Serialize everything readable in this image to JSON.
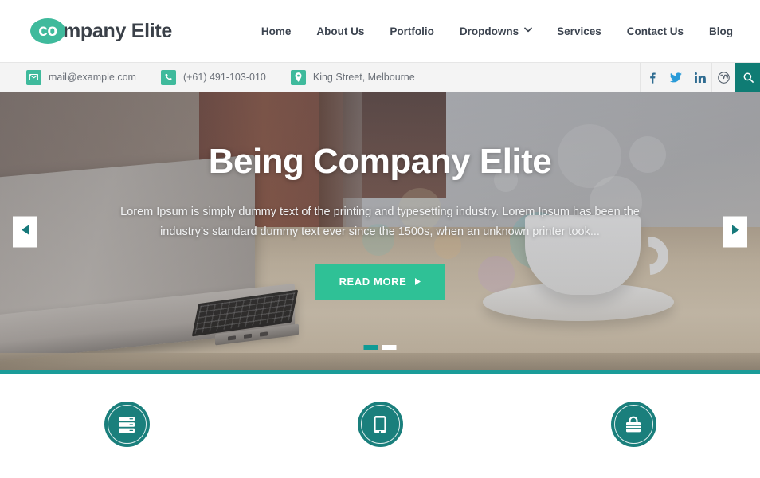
{
  "brand": {
    "logo_mark_text": "co",
    "logo_text": "mpany Elite",
    "accent_green": "#3fba9c",
    "accent_teal": "#0f7c74",
    "accent_button": "#2fc196",
    "dark_text": "#3a4048"
  },
  "nav": {
    "items": [
      {
        "label": "Home",
        "has_dropdown": false
      },
      {
        "label": "About Us",
        "has_dropdown": false
      },
      {
        "label": "Portfolio",
        "has_dropdown": false
      },
      {
        "label": "Dropdowns",
        "has_dropdown": true
      },
      {
        "label": "Services",
        "has_dropdown": false
      },
      {
        "label": "Contact Us",
        "has_dropdown": false
      },
      {
        "label": "Blog",
        "has_dropdown": false
      }
    ]
  },
  "topbar": {
    "contacts": [
      {
        "icon": "envelope-icon",
        "text": "mail@example.com"
      },
      {
        "icon": "phone-icon",
        "text": "(+61) 491-103-010"
      },
      {
        "icon": "map-pin-icon",
        "text": "King Street, Melbourne"
      }
    ],
    "socials": [
      {
        "icon": "facebook-icon",
        "label": "Facebook"
      },
      {
        "icon": "twitter-icon",
        "label": "Twitter"
      },
      {
        "icon": "linkedin-icon",
        "label": "LinkedIn"
      },
      {
        "icon": "wordpress-icon",
        "label": "WordPress"
      },
      {
        "icon": "search-icon",
        "label": "Search"
      }
    ]
  },
  "hero": {
    "title": "Being Company Elite",
    "subtitle": "Lorem Ipsum is simply dummy text of the printing and typesetting industry. Lorem Ipsum has been the industry’s standard dummy text ever since the 1500s, when an unknown printer took...",
    "cta_label": "READ MORE",
    "prev_label": "Previous slide",
    "next_label": "Next slide",
    "slides_total": 2,
    "slide_active": 1
  },
  "services": {
    "items": [
      {
        "icon": "server-icon",
        "label": "Hosting"
      },
      {
        "icon": "mobile-icon",
        "label": "Mobile"
      },
      {
        "icon": "shopping-bag-icon",
        "label": "Shop"
      }
    ]
  }
}
